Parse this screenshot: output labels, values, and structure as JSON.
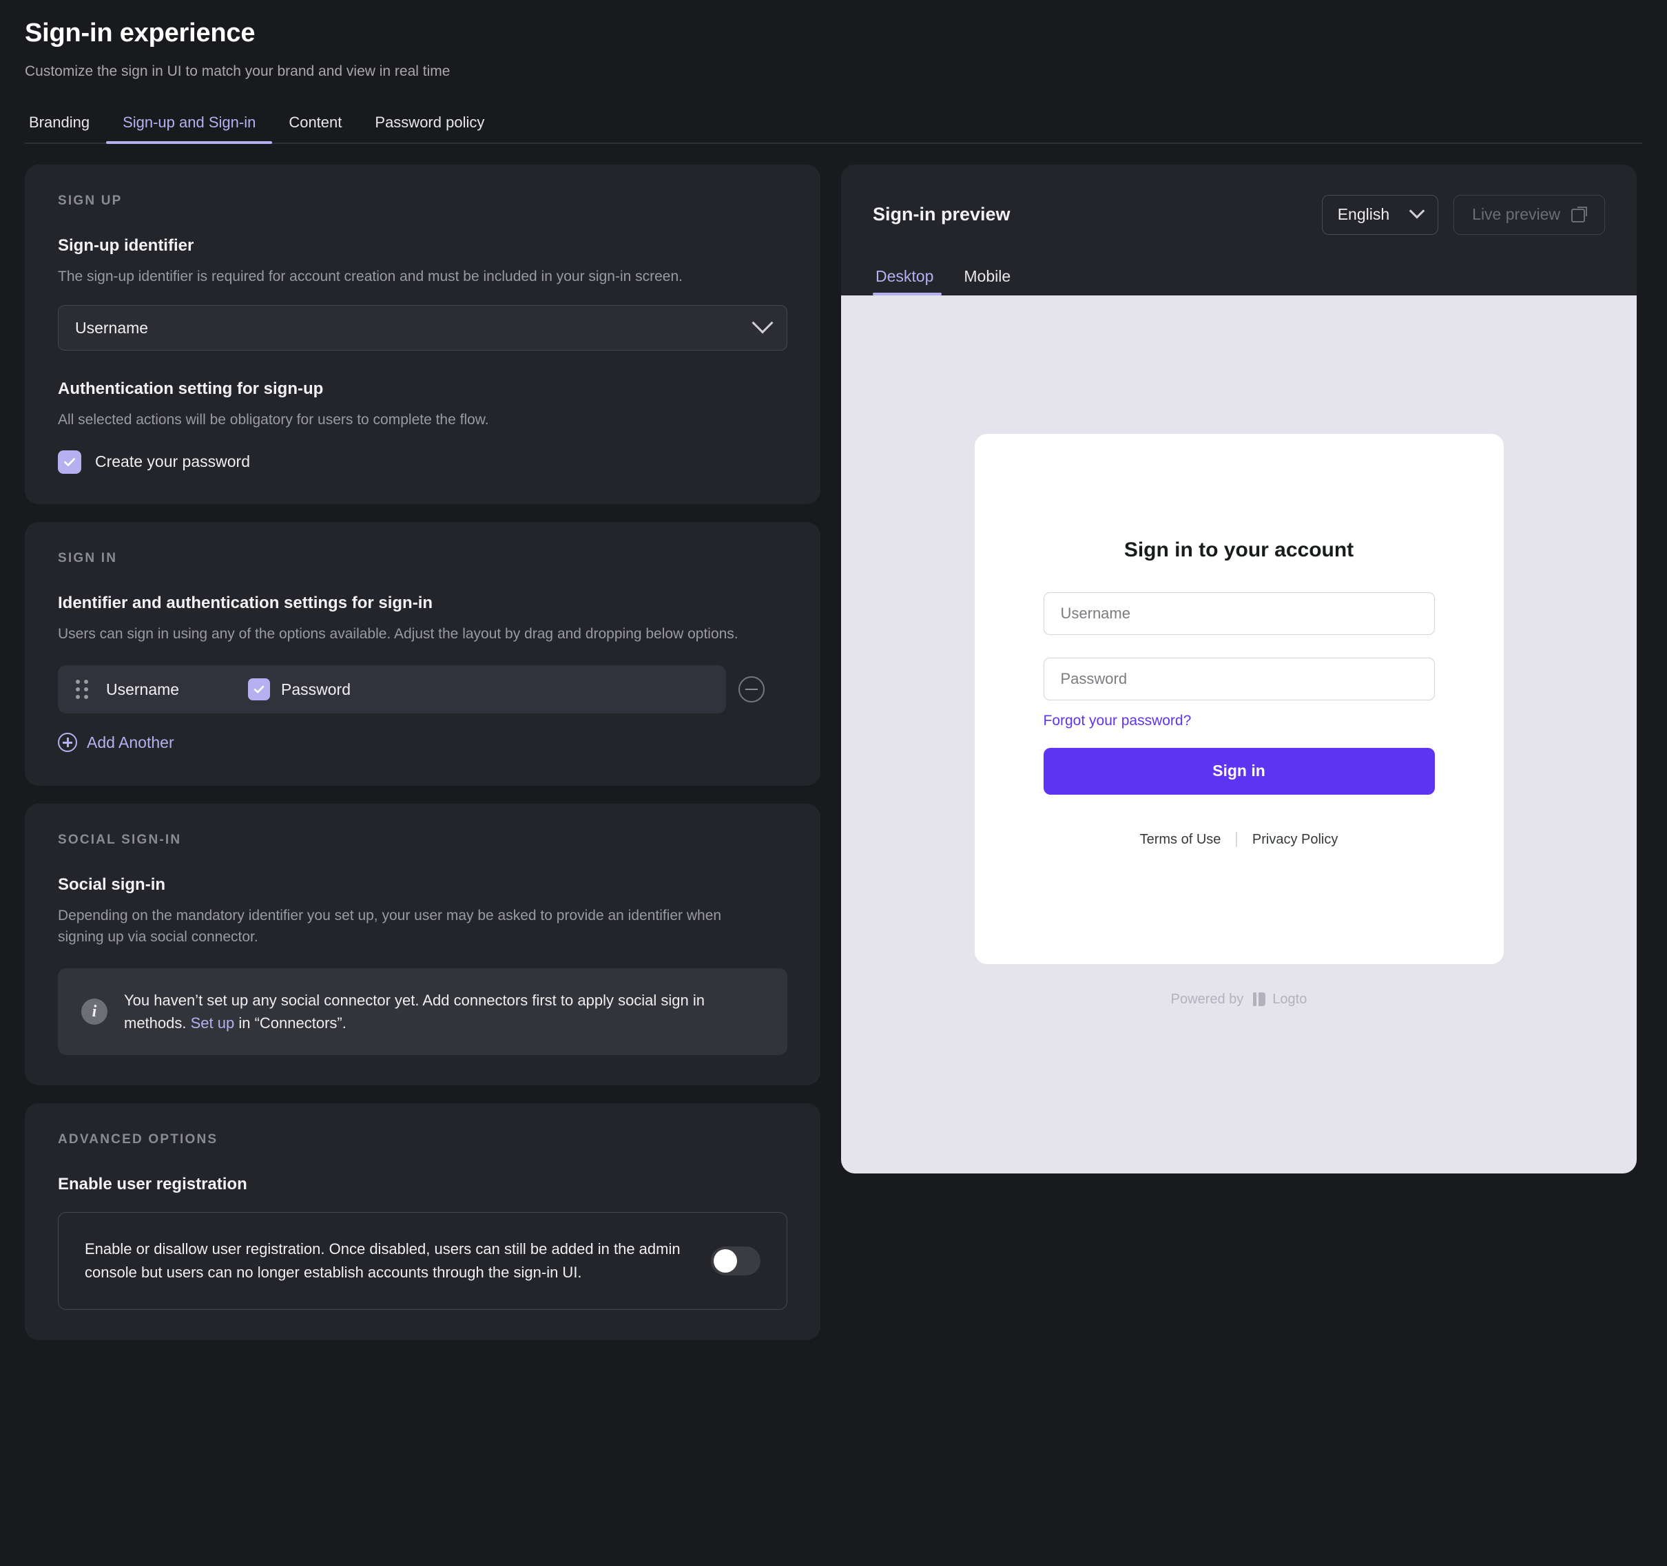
{
  "header": {
    "title": "Sign-in experience",
    "subtitle": "Customize the sign in UI to match your brand and view in real time"
  },
  "tabs": [
    {
      "label": "Branding",
      "active": false
    },
    {
      "label": "Sign-up and Sign-in",
      "active": true
    },
    {
      "label": "Content",
      "active": false
    },
    {
      "label": "Password policy",
      "active": false
    }
  ],
  "sign_up": {
    "eyebrow": "SIGN UP",
    "identifier_title": "Sign-up identifier",
    "identifier_desc": "The sign-up identifier is required for account creation and must be included in your sign-in screen.",
    "identifier_value": "Username",
    "auth_title": "Authentication setting for sign-up",
    "auth_desc": "All selected actions will be obligatory for users to complete the flow.",
    "auth_checkbox_label": "Create your password",
    "auth_checkbox_checked": true
  },
  "sign_in": {
    "eyebrow": "SIGN IN",
    "title": "Identifier and authentication settings for sign-in",
    "desc": "Users can sign in using any of the options available. Adjust the layout by drag and dropping below options.",
    "rows": [
      {
        "identifier": "Username",
        "auth_label": "Password",
        "auth_checked": true
      }
    ],
    "add_another_label": "Add Another"
  },
  "social": {
    "eyebrow": "SOCIAL SIGN-IN",
    "title": "Social sign-in",
    "desc": "Depending on the mandatory identifier you set up, your user may be asked to provide an identifier when signing up via social connector.",
    "alert_part1": "You haven’t set up any social connector yet. Add connectors first to apply social sign in methods. ",
    "alert_link": "Set up",
    "alert_part2": " in “Connectors”."
  },
  "advanced": {
    "eyebrow": "ADVANCED OPTIONS",
    "title": "Enable user registration",
    "toggle_desc": "Enable or disallow user registration. Once disabled, users can still be added in the admin console but users can no longer establish accounts through the sign-in UI.",
    "toggle_on": false
  },
  "preview": {
    "title": "Sign-in preview",
    "language": "English",
    "live_preview_label": "Live preview",
    "tabs": [
      {
        "label": "Desktop",
        "active": true
      },
      {
        "label": "Mobile",
        "active": false
      }
    ],
    "card": {
      "heading": "Sign in to your account",
      "username_placeholder": "Username",
      "password_placeholder": "Password",
      "forgot_label": "Forgot your password?",
      "submit_label": "Sign in",
      "terms_label": "Terms of Use",
      "privacy_label": "Privacy Policy"
    },
    "powered_by": "Powered by",
    "brand": "Logto"
  },
  "colors": {
    "accent_purple": "#b6aff0",
    "brand_button": "#5d34f2",
    "page_bg": "#191a1e",
    "card_bg": "#24252a",
    "preview_stage_bg": "#e5e3ec"
  }
}
